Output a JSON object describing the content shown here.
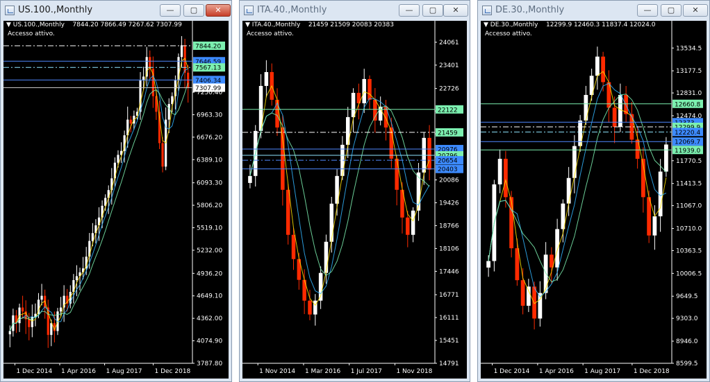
{
  "windows": [
    {
      "title": "US.100.,Monthly",
      "active": true,
      "header": {
        "symbol": "US.100.,Monthly",
        "ohlc": "7844.20 7866.49 7267.62 7307.99",
        "status": "Accesso attivo."
      },
      "controls": {
        "minimize": "—",
        "maximize": "▢",
        "close": "✕"
      },
      "price_scale": {
        "ticks": [
          "3787.80",
          "4074.90",
          "4362.00",
          "4649.10",
          "4936.20",
          "5232.00",
          "5519.10",
          "5806.20",
          "6093.30",
          "6389.10",
          "6676.20",
          "6963.30",
          "7250.40"
        ],
        "min": 3787.8,
        "max": 7950
      },
      "time_labels": [
        {
          "label": "1 Dec 2014",
          "pos": 0.05
        },
        {
          "label": "1 Apr 2016",
          "pos": 0.29
        },
        {
          "label": "1 Aug 2017",
          "pos": 0.53
        },
        {
          "label": "1 Dec 2018",
          "pos": 0.79
        }
      ],
      "levels": [
        {
          "price": 7844.2,
          "label": "7844.20",
          "style": "dashdot",
          "color": "#ffffff",
          "label_bg": "#7cf0b0",
          "label_fg": "#000000"
        },
        {
          "price": 7646.59,
          "label": "7646.59",
          "style": "solid",
          "color": "#4f89ff",
          "label_bg": "#3d8bff",
          "label_fg": "#000000"
        },
        {
          "price": 7567.13,
          "label": "7567.13",
          "style": "dashdot",
          "color": "#8fe6ff",
          "label_bg": "#7cf0b0",
          "label_fg": "#000000"
        },
        {
          "price": 7406.34,
          "label": "7406.34",
          "style": "solid",
          "color": "#4f89ff",
          "label_bg": "#3d8bff",
          "label_fg": "#000000"
        },
        {
          "price": 7307.99,
          "label": "7307.99",
          "style": "solid",
          "color": "#c8c8c8",
          "label_bg": "#ffffff",
          "label_fg": "#000000"
        }
      ],
      "chart_data": {
        "type": "candlestick",
        "monthly_closes": [
          4200,
          4400,
          4300,
          4500,
          4450,
          4350,
          4250,
          4380,
          4420,
          4600,
          4650,
          4500,
          4150,
          4300,
          4200,
          4450,
          4500,
          4650,
          4550,
          4700,
          4850,
          4900,
          4950,
          5000,
          5150,
          5350,
          5450,
          5550,
          5650,
          5800,
          5900,
          6000,
          6150,
          6350,
          6450,
          6500,
          6700,
          6900,
          6850,
          6950,
          7000,
          7400,
          7450,
          7700,
          7550,
          7200,
          7000,
          6600,
          6300,
          6900,
          7100,
          7200,
          7400,
          7700,
          7850,
          7500,
          7307.99
        ]
      }
    },
    {
      "title": "ITA.40.,Monthly",
      "active": false,
      "header": {
        "symbol": "ITA.40.,Monthly",
        "ohlc": "21459 21509 20083 20383",
        "status": "Accesso attivo."
      },
      "controls": {
        "minimize": "—",
        "maximize": "▢",
        "close": "✕"
      },
      "price_scale": {
        "ticks": [
          "14791",
          "15451",
          "16111",
          "16771",
          "17446",
          "18106",
          "18766",
          "19426",
          "20086",
          "20751",
          "21416",
          "22076",
          "22726",
          "23401",
          "24061"
        ],
        "min": 14791,
        "max": 24200
      },
      "time_labels": [
        {
          "label": "1 Nov 2014",
          "pos": 0.07
        },
        {
          "label": "1 Mar 2016",
          "pos": 0.31
        },
        {
          "label": "1 Jul 2017",
          "pos": 0.55
        },
        {
          "label": "1 Nov 2018",
          "pos": 0.79
        }
      ],
      "levels": [
        {
          "price": 22122,
          "label": "22122",
          "style": "solid",
          "color": "#7cf0b0",
          "label_bg": "#7cf0b0",
          "label_fg": "#000000"
        },
        {
          "price": 21459,
          "label": "21459",
          "style": "dashdot",
          "color": "#ffffff",
          "label_bg": "#7cf0b0",
          "label_fg": "#000000"
        },
        {
          "price": 20976,
          "label": "20976",
          "style": "solid",
          "color": "#4f89ff",
          "label_bg": "#3d8bff",
          "label_fg": "#000000"
        },
        {
          "price": 20796,
          "label": "20796",
          "style": "solid",
          "color": "#8fe6ff",
          "label_bg": "#7cf0b0",
          "label_fg": "#000000"
        },
        {
          "price": 20654,
          "label": "20654",
          "style": "dashdot",
          "color": "#4f89ff",
          "label_bg": "#3d8bff",
          "label_fg": "#000000"
        },
        {
          "price": 20403,
          "label": "20403",
          "style": "solid",
          "color": "#4f89ff",
          "label_bg": "#3d8bff",
          "label_fg": "#000000"
        }
      ],
      "chart_data": {
        "type": "candlestick",
        "monthly_closes": [
          20200,
          21500,
          22800,
          23200,
          22400,
          21600,
          19800,
          18500,
          17800,
          17200,
          16600,
          16200,
          16600,
          17400,
          18300,
          19400,
          20200,
          21100,
          21900,
          22600,
          22300,
          23000,
          22400,
          21800,
          22200,
          21600,
          20700,
          19800,
          19000,
          18500,
          19200,
          20300,
          21300,
          20383
        ]
      }
    },
    {
      "title": "DE.30.,Monthly",
      "active": false,
      "header": {
        "symbol": "DE.30.,Monthly",
        "ohlc": "12299.9 12460.3 11837.4 12024.0",
        "status": "Accesso attivo."
      },
      "controls": {
        "minimize": "—",
        "maximize": "▢",
        "close": "✕"
      },
      "price_scale": {
        "ticks": [
          "8599.5",
          "8946.0",
          "9303.0",
          "9649.5",
          "10006.5",
          "10363.5",
          "10710.0",
          "11067.0",
          "11413.5",
          "11770.5",
          "12474.0",
          "12831.0",
          "13177.5",
          "13534.5"
        ],
        "min": 8599.5,
        "max": 13700
      },
      "time_labels": [
        {
          "label": "1 Dec 2014",
          "pos": 0.05
        },
        {
          "label": "1 Apr 2016",
          "pos": 0.29
        },
        {
          "label": "1 Aug 2017",
          "pos": 0.53
        },
        {
          "label": "1 Dec 2018",
          "pos": 0.79
        }
      ],
      "levels": [
        {
          "price": 12660.8,
          "label": "12660.8",
          "style": "solid",
          "color": "#7cf0b0",
          "label_bg": "#7cf0b0",
          "label_fg": "#000000"
        },
        {
          "price": 12373,
          "label": "12373",
          "style": "solid",
          "color": "#4f89ff",
          "label_bg": "#3d8bff",
          "label_fg": "#000000"
        },
        {
          "price": 12299.9,
          "label": "12299.9",
          "style": "dashdot",
          "color": "#ffffff",
          "label_bg": "#7cf0b0",
          "label_fg": "#000000"
        },
        {
          "price": 12220.4,
          "label": "12220.4",
          "style": "dashdot",
          "color": "#8fe6ff",
          "label_bg": "#3d8bff",
          "label_fg": "#000000"
        },
        {
          "price": 12069.7,
          "label": "12069.7",
          "style": "solid",
          "color": "#4f89ff",
          "label_bg": "#3d8bff",
          "label_fg": "#000000"
        },
        {
          "price": 11939.0,
          "label": "11939.0",
          "style": "solid",
          "color": "#7cf0b0",
          "label_bg": "#7cf0b0",
          "label_fg": "#000000"
        }
      ],
      "chart_data": {
        "type": "candlestick",
        "monthly_closes": [
          10200,
          11400,
          11800,
          11200,
          10400,
          9900,
          9500,
          9800,
          9300,
          9700,
          10300,
          10100,
          10700,
          11100,
          11500,
          12000,
          12400,
          12800,
          13100,
          13400,
          13000,
          12600,
          12300,
          12800,
          12500,
          12100,
          11800,
          11200,
          10600,
          10900,
          11600,
          12024
        ]
      }
    }
  ]
}
